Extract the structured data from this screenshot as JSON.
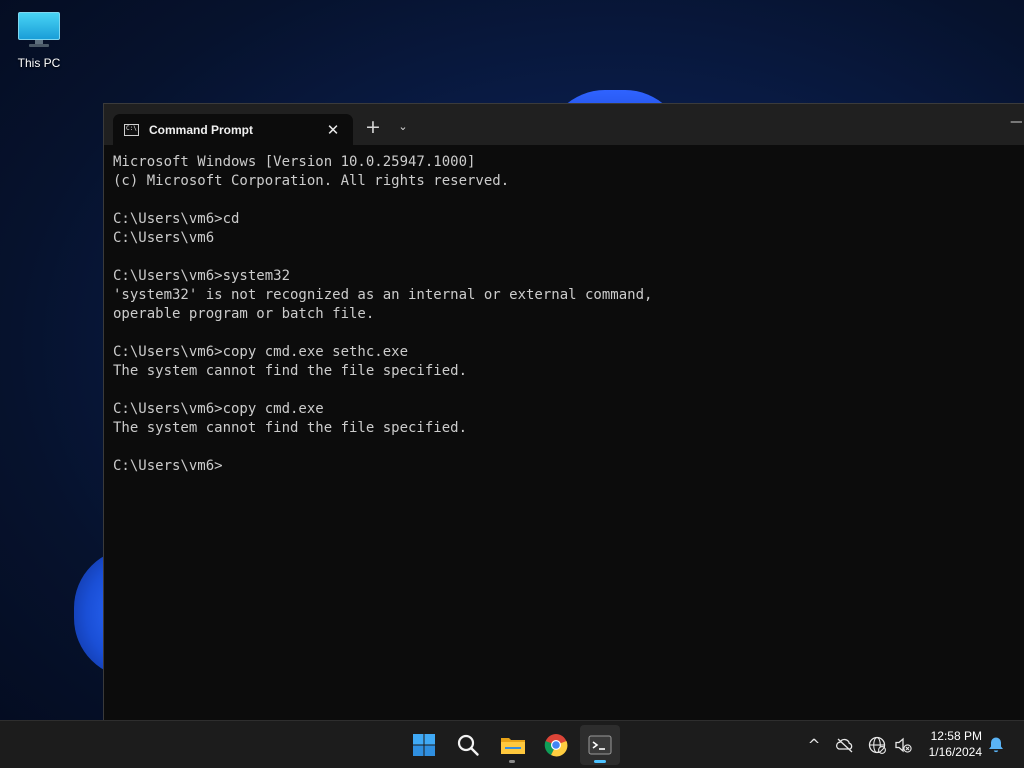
{
  "desktop": {
    "icons": [
      {
        "label": "This PC",
        "icon": "this-pc-icon"
      }
    ]
  },
  "window": {
    "tab_title": "Command Prompt",
    "tab_icon": "cmd-icon",
    "tab_icon_text": "C:\\",
    "close_glyph": "✕",
    "new_tab_glyph": "+",
    "dropdown_glyph": "⌄",
    "minimize_glyph": "—",
    "console_lines": [
      "Microsoft Windows [Version 10.0.25947.1000]",
      "(c) Microsoft Corporation. All rights reserved.",
      "",
      "C:\\Users\\vm6>cd",
      "C:\\Users\\vm6",
      "",
      "C:\\Users\\vm6>system32",
      "'system32' is not recognized as an internal or external command,",
      "operable program or batch file.",
      "",
      "C:\\Users\\vm6>copy cmd.exe sethc.exe",
      "The system cannot find the file specified.",
      "",
      "C:\\Users\\vm6>copy cmd.exe",
      "The system cannot find the file specified.",
      "",
      "C:\\Users\\vm6>"
    ]
  },
  "taskbar": {
    "apps": [
      {
        "name": "start",
        "icon": "windows-start-icon"
      },
      {
        "name": "search",
        "icon": "search-icon"
      },
      {
        "name": "file-explorer",
        "icon": "folder-icon"
      },
      {
        "name": "chrome",
        "icon": "chrome-icon"
      },
      {
        "name": "terminal",
        "icon": "terminal-icon",
        "active": true
      }
    ],
    "tray": {
      "icons": [
        "chevron-up-icon",
        "onedrive-offline-icon",
        "network-globe-icon",
        "volume-muted-icon",
        "notification-bell-icon"
      ],
      "chevron_glyph": "^",
      "time": "12:58 PM",
      "date": "1/16/2024"
    }
  },
  "colors": {
    "console_text": "#cccccc",
    "console_bg": "#0c0c0c",
    "titlebar_bg": "#202020",
    "taskbar_bg": "#1c1c1c",
    "accent": "#4cc2ff"
  }
}
